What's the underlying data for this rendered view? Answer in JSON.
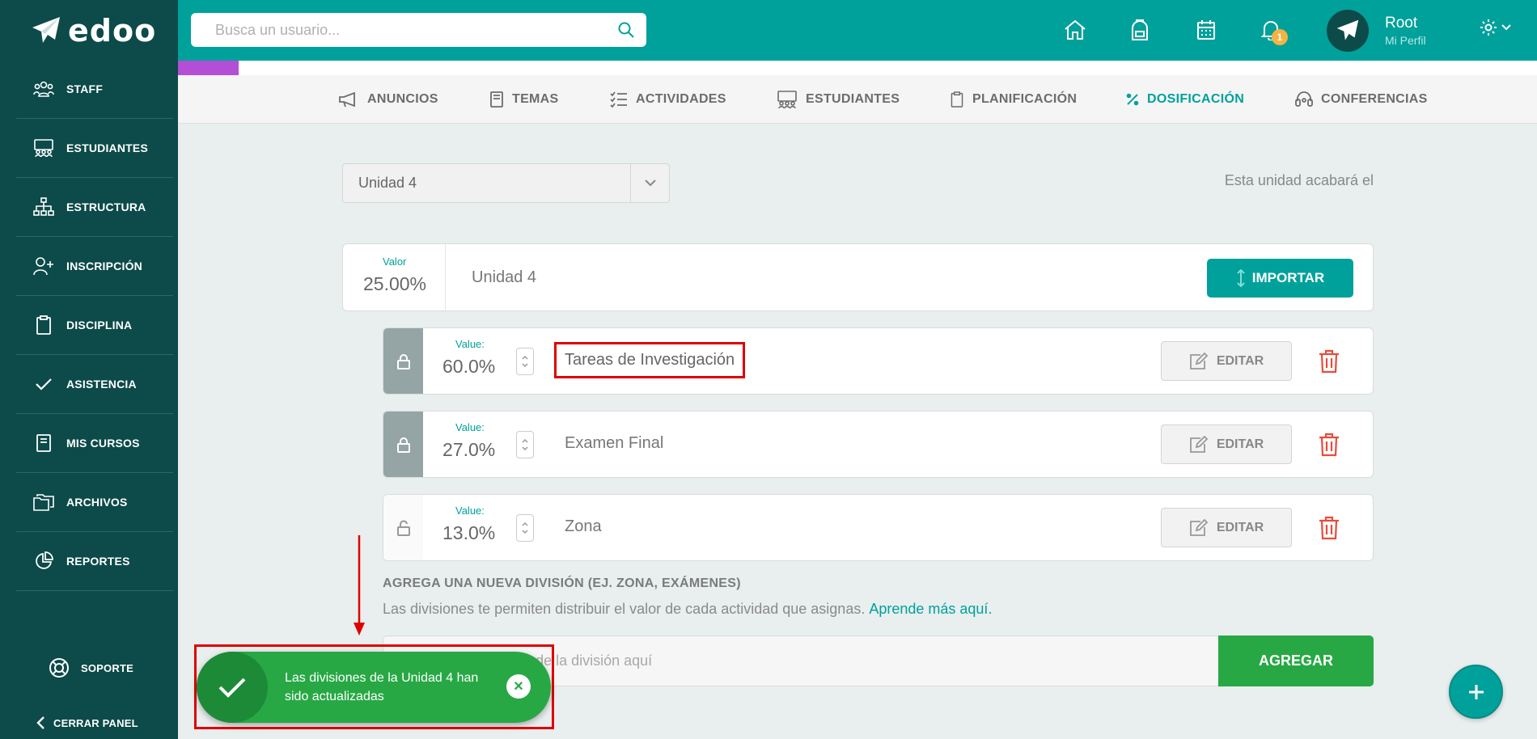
{
  "app": {
    "logo_text": "edoo"
  },
  "sidebar": {
    "items": [
      {
        "label": "STAFF",
        "icon": "users-icon"
      },
      {
        "label": "ESTUDIANTES",
        "icon": "students-icon"
      },
      {
        "label": "ESTRUCTURA",
        "icon": "hierarchy-icon"
      },
      {
        "label": "INSCRIPCIÓN",
        "icon": "add-user-icon"
      },
      {
        "label": "DISCIPLINA",
        "icon": "clipboard-icon"
      },
      {
        "label": "ASISTENCIA",
        "icon": "check-icon"
      },
      {
        "label": "MIS CURSOS",
        "icon": "book-icon"
      },
      {
        "label": "ARCHIVOS",
        "icon": "folders-icon"
      },
      {
        "label": "REPORTES",
        "icon": "pie-chart-icon"
      }
    ],
    "support": "SOPORTE",
    "close_panel": "CERRAR PANEL"
  },
  "header": {
    "search_placeholder": "Busca un usuario...",
    "notifications_count": "1",
    "profile_name": "Root",
    "profile_sub": "Mi Perfil"
  },
  "tabs": [
    {
      "label": "ANUNCIOS",
      "icon": "megaphone-icon"
    },
    {
      "label": "TEMAS",
      "icon": "book-icon"
    },
    {
      "label": "ACTIVIDADES",
      "icon": "checklist-icon"
    },
    {
      "label": "ESTUDIANTES",
      "icon": "students-icon"
    },
    {
      "label": "PLANIFICACIÓN",
      "icon": "clipboard-icon"
    },
    {
      "label": "DOSIFICACIÓN",
      "icon": "percent-icon"
    },
    {
      "label": "CONFERENCIAS",
      "icon": "headset-icon"
    }
  ],
  "unit": {
    "selected": "Unidad 4",
    "end_text": "Esta unidad acabará el",
    "valor_label": "Valor",
    "valor_value": "25.00%",
    "name": "Unidad 4",
    "import_label": "IMPORTAR"
  },
  "divisions": [
    {
      "value_label": "Value:",
      "value": "60.0%",
      "name": "Tareas de Investigación",
      "edit_label": "EDITAR",
      "locked": true
    },
    {
      "value_label": "Value:",
      "value": "27.0%",
      "name": "Examen Final",
      "edit_label": "EDITAR",
      "locked": true
    },
    {
      "value_label": "Value:",
      "value": "13.0%",
      "name": "Zona",
      "edit_label": "EDITAR",
      "locked": false
    }
  ],
  "new_division": {
    "title": "AGREGA UNA NUEVA DIVISIÓN (EJ. ZONA, EXÁMENES)",
    "description": "Las divisiones te permiten distribuir el valor de cada actividad que asignas.",
    "link": "Aprende más aquí.",
    "placeholder": "Escribe el nombre de la división aquí",
    "button": "AGREGAR"
  },
  "toast": {
    "message": "Las divisiones de la Unidad 4 han sido actualizadas",
    "close": "×"
  },
  "colors": {
    "primary": "#00a19b",
    "sidebar": "#0d4a4a",
    "success": "#27a844",
    "danger": "#e74c3c",
    "accent": "#b44ed6",
    "annotation": "#e00000"
  }
}
